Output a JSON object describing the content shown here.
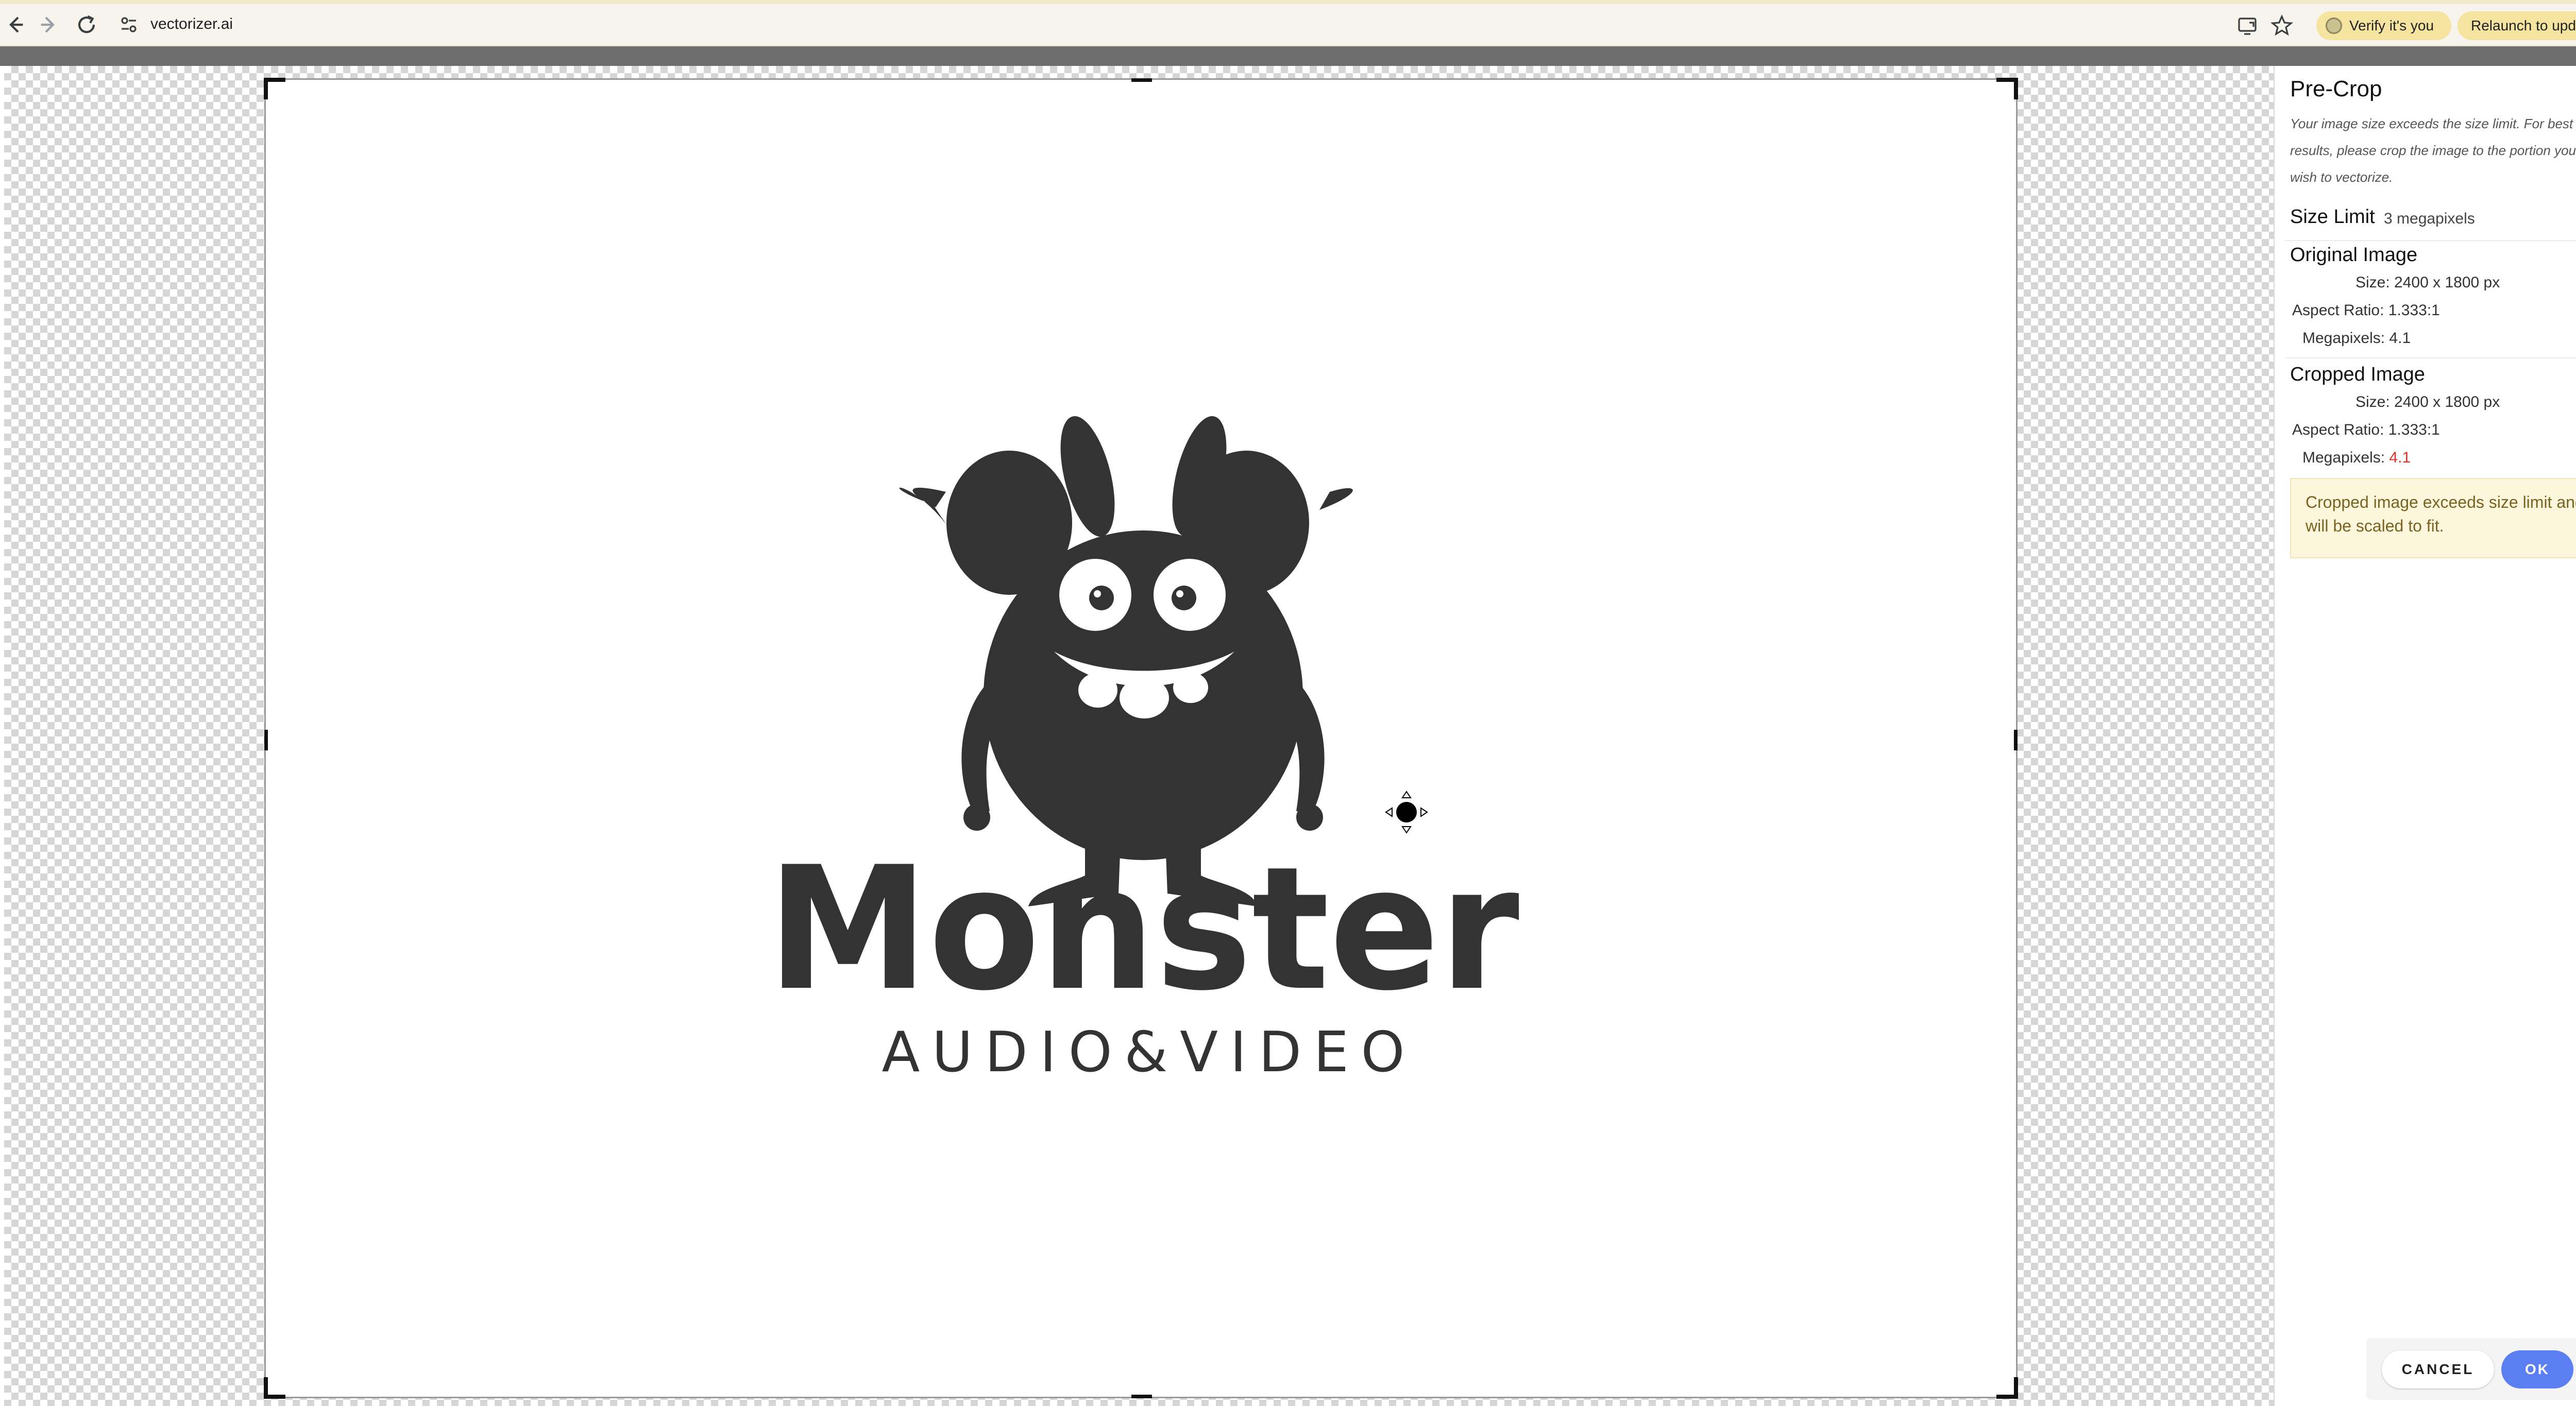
{
  "browser": {
    "url": "vectorizer.ai",
    "verify_label": "Verify it's you",
    "relaunch_label": "Relaunch to update",
    "icons": [
      "back-icon",
      "forward-icon",
      "reload-icon",
      "site-info-icon",
      "install-icon",
      "bookmark-star-icon",
      "menu-dots-icon"
    ]
  },
  "logo": {
    "name": "Monster",
    "tagline": "AUDIO&VIDEO"
  },
  "panel": {
    "title": "Pre-Crop",
    "description": "Your image size exceeds the size limit. For best results, please crop the image to the portion you wish to vectorize.",
    "size_limit": {
      "label": "Size Limit",
      "value": "3 megapixels"
    },
    "original": {
      "title": "Original Image",
      "size_label": "Size:",
      "size_value": "2400 x 1800 px",
      "aspect_label": "Aspect Ratio:",
      "aspect_value": "1.333:1",
      "mp_label": "Megapixels:",
      "mp_value": "4.1"
    },
    "cropped": {
      "title": "Cropped Image",
      "size_label": "Size:",
      "size_value": "2400 x 1800 px",
      "aspect_label": "Aspect Ratio:",
      "aspect_value": "1.333:1",
      "mp_label": "Megapixels:",
      "mp_value": "4.1"
    },
    "warning": "Cropped image exceeds size limit and will be scaled to fit.",
    "cancel_label": "CANCEL",
    "ok_label": "OK"
  },
  "colors": {
    "accent": "#5b7ff2",
    "over_limit": "#e0322b",
    "warning_bg": "#fbf6dc",
    "logo_fill": "#333333"
  }
}
